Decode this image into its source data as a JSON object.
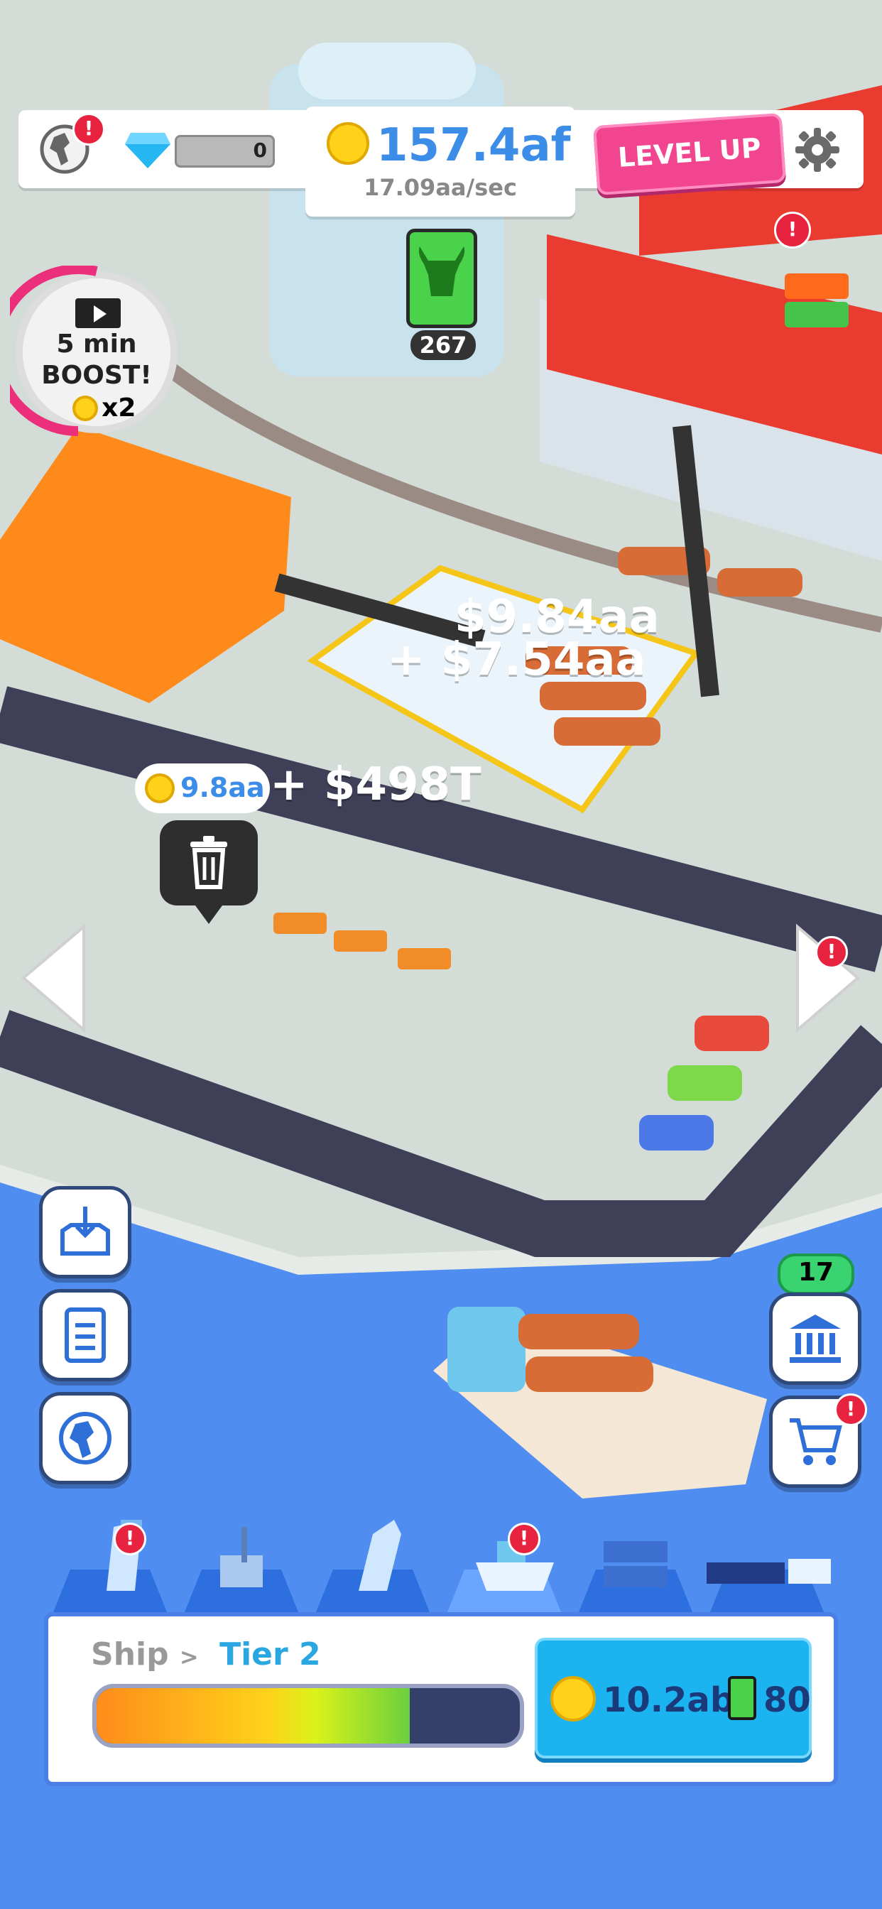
{
  "header": {
    "gems": "0",
    "money": "157.4af",
    "rate": "17.09aa/sec",
    "level_up_label": "LEVEL UP",
    "world_alert": "!"
  },
  "resource_tile": {
    "count": "267",
    "icon": "bull-icon"
  },
  "boost": {
    "line1": "5 min",
    "line2": "BOOST!",
    "multiplier": "x2"
  },
  "floating_income": [
    {
      "text": "$9.84aa"
    },
    {
      "text": "+ $7.54aa"
    },
    {
      "text": "+ $498T"
    }
  ],
  "slot_price": "9.8aa",
  "side_left": {
    "icons": [
      "inbox-download-icon",
      "document-list-icon",
      "globe-africa-icon"
    ]
  },
  "side_right": {
    "bank_count": "17",
    "icons": [
      "bank-icon",
      "cart-icon"
    ],
    "alert": "!"
  },
  "tabs": [
    {
      "icon": "crane-icon",
      "alert": true
    },
    {
      "icon": "forklift-icon",
      "alert": false
    },
    {
      "icon": "excavator-icon",
      "alert": false
    },
    {
      "icon": "ship-icon",
      "alert": true
    },
    {
      "icon": "containers-icon",
      "alert": false
    },
    {
      "icon": "train-truck-icon",
      "alert": false
    }
  ],
  "panel": {
    "category": "Ship",
    "separator": ">",
    "tier": "Tier 2",
    "progress": 0.74,
    "cost_coins": "10.2ab",
    "cost_resource": "80"
  },
  "colors": {
    "sea": "#4f8df0",
    "road": "#3f3f58",
    "ground": "#d4dcd7",
    "accent": "#3c8de8",
    "level_up": "#f2458f",
    "buy_button": "#1cb4f0"
  }
}
